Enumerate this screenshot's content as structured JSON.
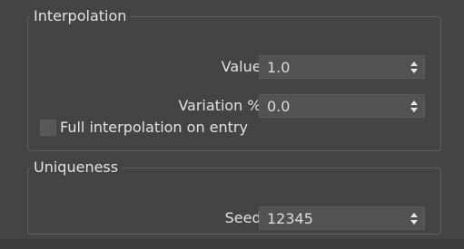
{
  "interpolation": {
    "title": "Interpolation",
    "value_label": "Value:",
    "value": "1.0",
    "variation_label": "Variation %:",
    "variation": "0.0",
    "full_interp_label": "Full interpolation on entry",
    "full_interp_checked": false
  },
  "uniqueness": {
    "title": "Uniqueness",
    "seed_label": "Seed:",
    "seed": "12345"
  },
  "icons": {
    "spinner_up": "spinner-up-arrow-icon",
    "spinner_down": "spinner-down-arrow-icon"
  },
  "colors": {
    "panel_bg": "#444444",
    "field_bg": "#525252",
    "group_border": "#5e5e5e",
    "text": "#e2e2e2"
  }
}
